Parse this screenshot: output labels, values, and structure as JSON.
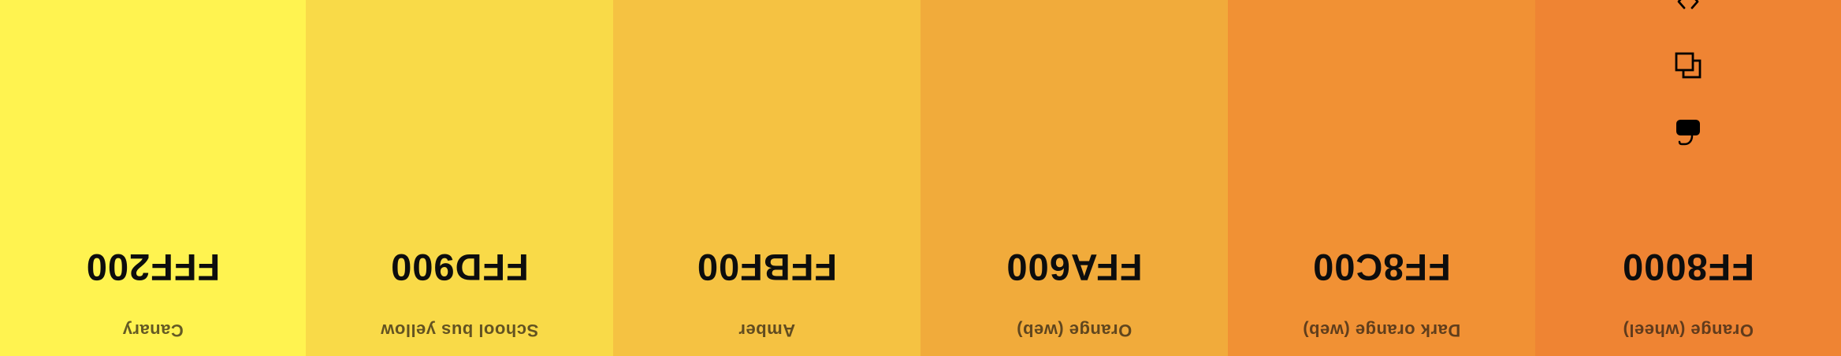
{
  "palette": {
    "swatches": [
      {
        "name": "Orange (wheel)",
        "hex": "FF8000",
        "color": "#EF8433"
      },
      {
        "name": "Dark orange (web)",
        "hex": "FF8C00",
        "color": "#F19134"
      },
      {
        "name": "Orange (web)",
        "hex": "FFA600",
        "color": "#F1AB3B"
      },
      {
        "name": "Amber",
        "hex": "FFBF00",
        "color": "#F5C242"
      },
      {
        "name": "School bus yellow",
        "hex": "FFD900",
        "color": "#F9DA48"
      },
      {
        "name": "Canary",
        "hex": "FFF200",
        "color": "#FFF350"
      }
    ],
    "tools": [
      {
        "icon": "comment-icon"
      },
      {
        "icon": "copy-icon"
      },
      {
        "icon": "code-icon"
      }
    ]
  }
}
